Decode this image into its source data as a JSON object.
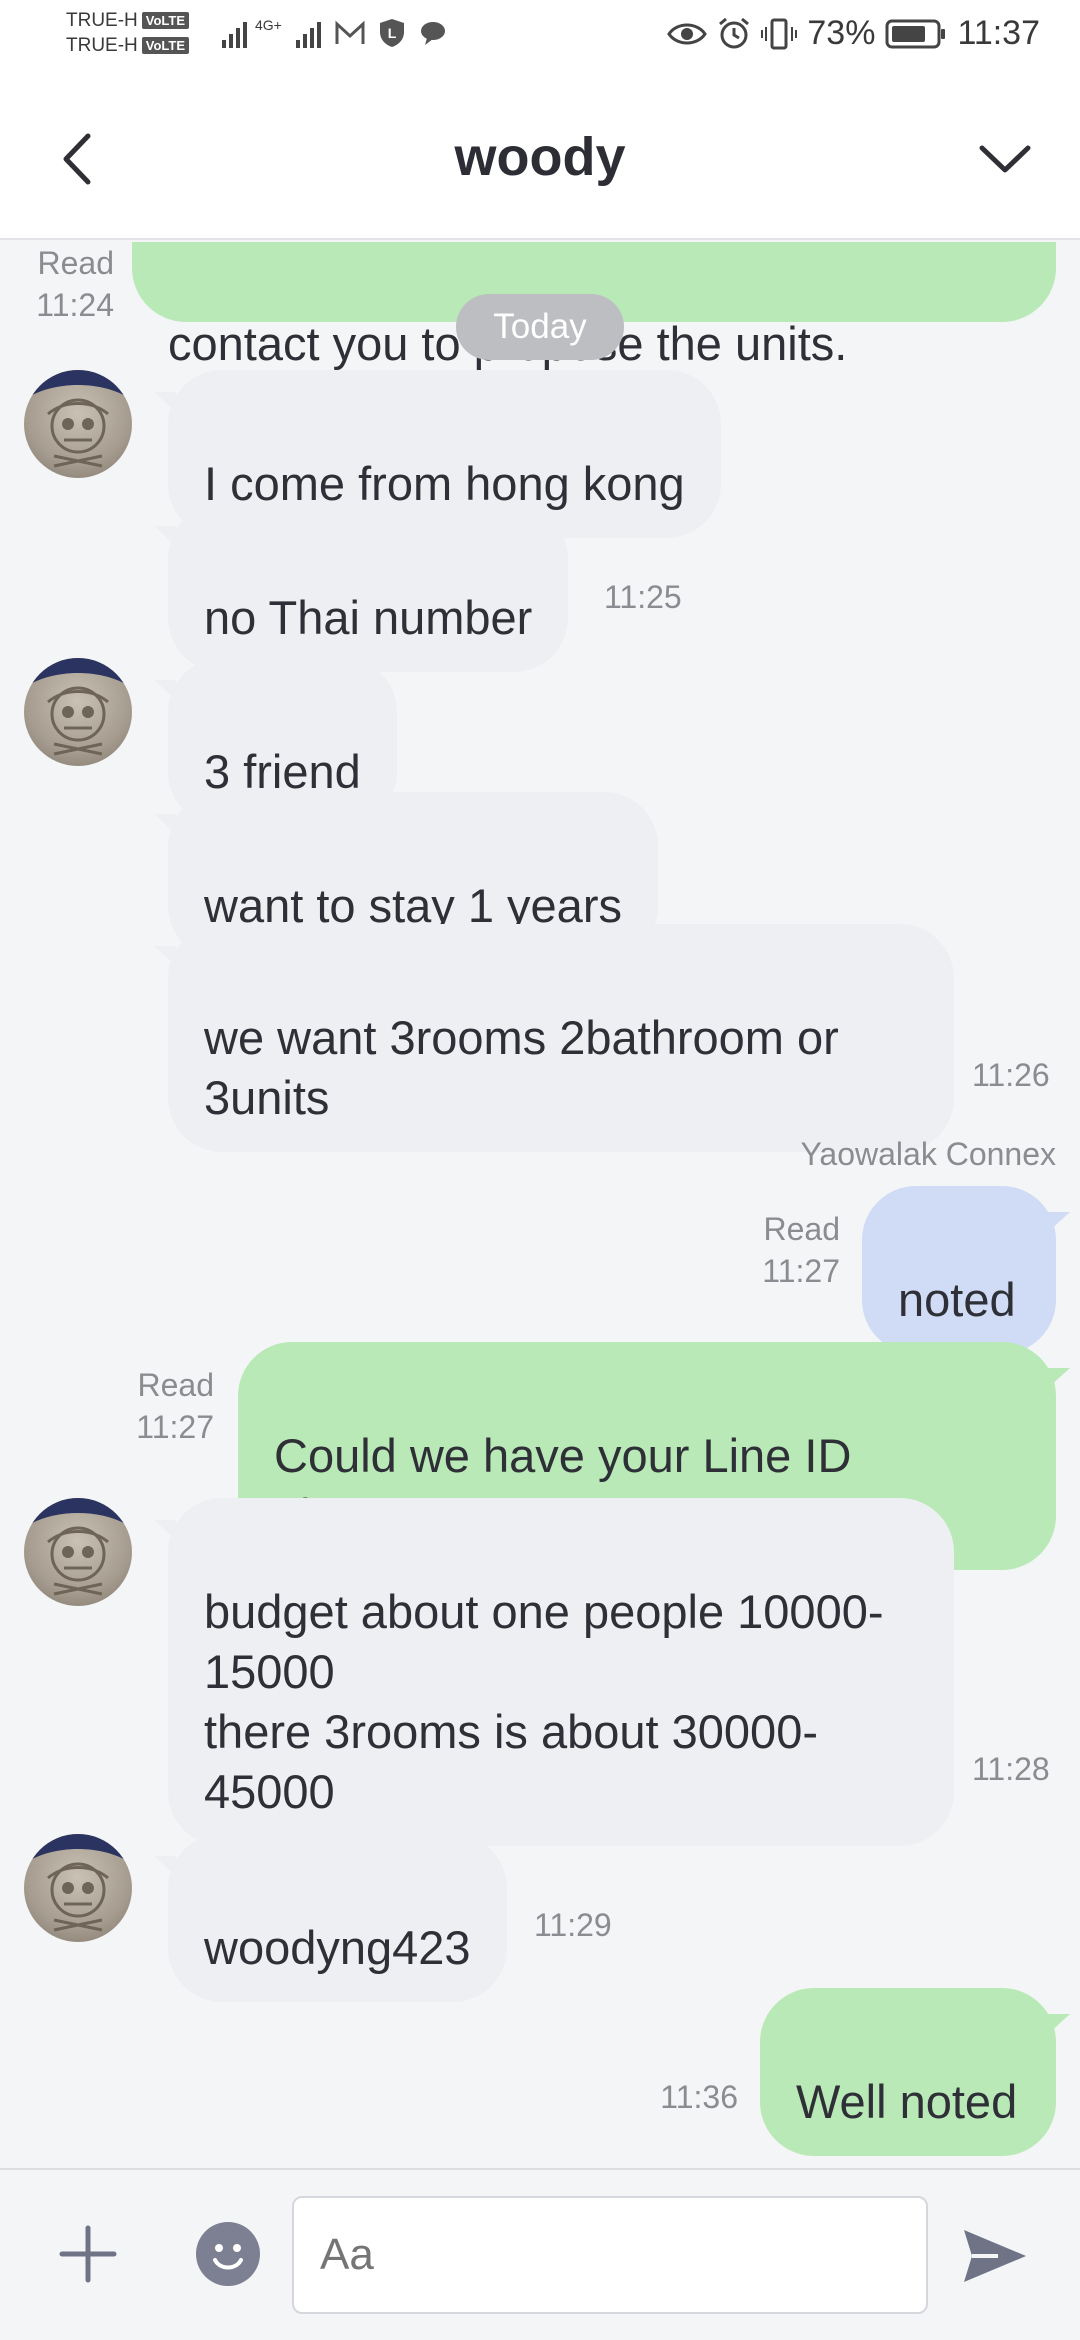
{
  "status_bar": {
    "carrier1": "TRUE-H",
    "carrier2": "TRUE-H",
    "volte": "VoLTE",
    "network": "4G+",
    "battery": "73%",
    "time": "11:37"
  },
  "header": {
    "title": "woody"
  },
  "chat": {
    "top_partial": {
      "text": "contact you to propose the units.",
      "read": "Read",
      "time": "11:24"
    },
    "day_chip": "Today",
    "msg1": {
      "text": "I come from hong kong"
    },
    "msg2": {
      "text": "no Thai number",
      "time": "11:25"
    },
    "msg3": {
      "text": "3 friend"
    },
    "msg4": {
      "text": "want to stay 1 years"
    },
    "msg5": {
      "text": "we want 3rooms 2bathroom or\n3units",
      "time": "11:26"
    },
    "sender_name": "Yaowalak Connex",
    "msg6": {
      "text": "noted",
      "read": "Read",
      "time": "11:27"
    },
    "msg7": {
      "text": "Could we have your Line ID please?",
      "read": "Read",
      "time": "11:27"
    },
    "msg8": {
      "text": "budget about one people 10000-\n15000\nthere 3rooms is about 30000-\n45000",
      "time": "11:28"
    },
    "msg9": {
      "text": "woodyng423",
      "time": "11:29"
    },
    "msg10": {
      "text": "Well noted",
      "time": "11:36"
    }
  },
  "input": {
    "placeholder": "Aa"
  },
  "colors": {
    "outgoing_green": "#b9e9b6",
    "outgoing_blue": "#d0dcf5",
    "incoming_gray": "#eeeff2",
    "icon_gray": "#7c8092"
  }
}
